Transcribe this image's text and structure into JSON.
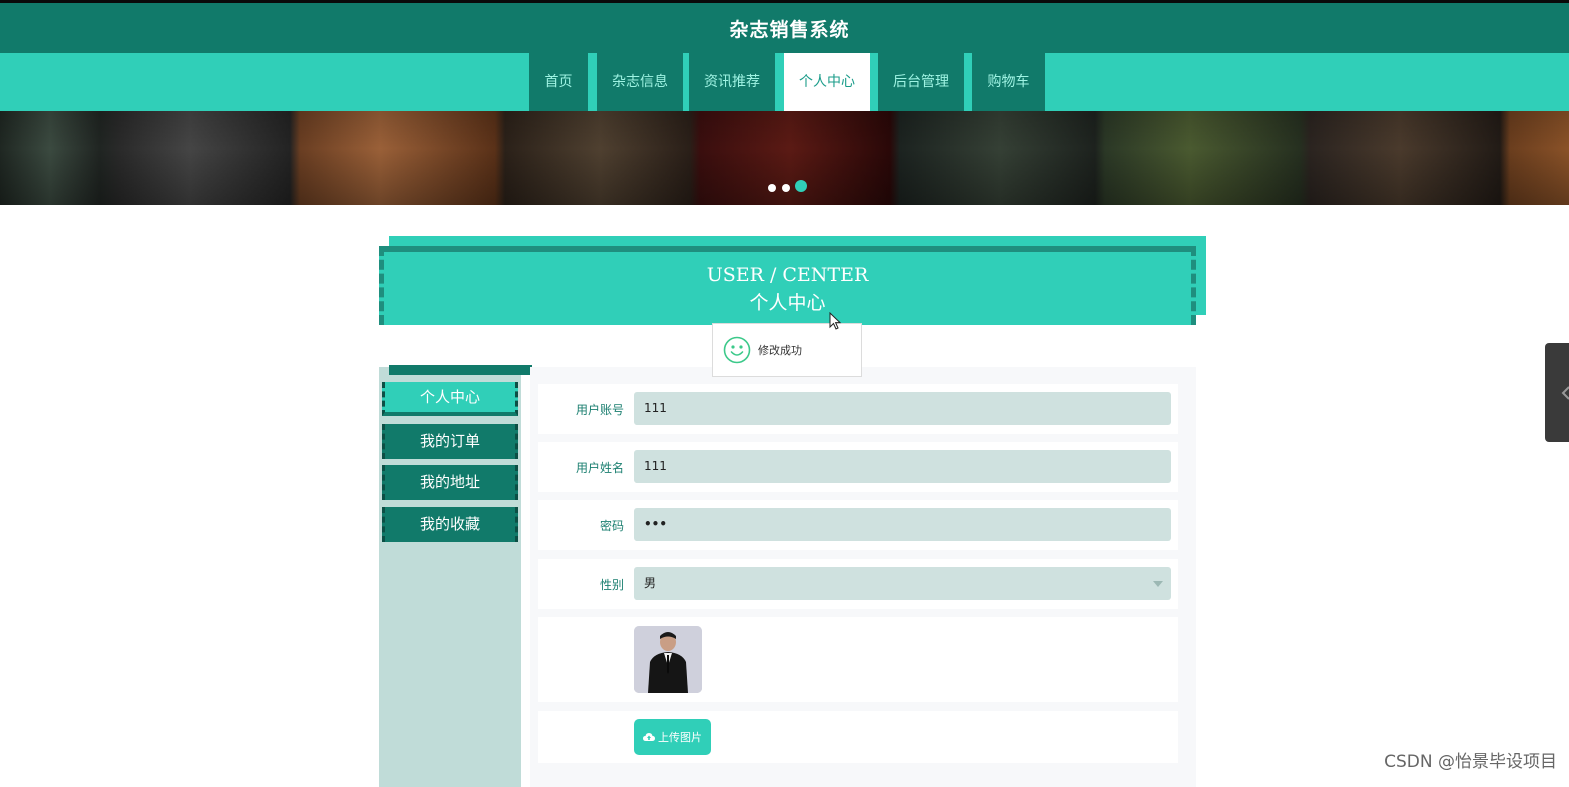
{
  "header": {
    "title": "杂志销售系统"
  },
  "nav": {
    "items": [
      {
        "label": "首页"
      },
      {
        "label": "杂志信息"
      },
      {
        "label": "资讯推荐"
      },
      {
        "label": "个人中心",
        "active": true
      },
      {
        "label": "后台管理"
      },
      {
        "label": "购物车"
      }
    ]
  },
  "banner": {
    "slide_count": 3,
    "active_slide": 3
  },
  "section": {
    "title_en": "USER / CENTER",
    "title_cn": "个人中心"
  },
  "toast": {
    "message": "修改成功",
    "icon": "smile-icon"
  },
  "sidebar": {
    "items": [
      {
        "label": "个人中心",
        "active": true
      },
      {
        "label": "我的订单"
      },
      {
        "label": "我的地址"
      },
      {
        "label": "我的收藏"
      }
    ]
  },
  "form": {
    "account": {
      "label": "用户账号",
      "value": "111"
    },
    "name": {
      "label": "用户姓名",
      "value": "111"
    },
    "password": {
      "label": "密码",
      "value": "•••"
    },
    "gender": {
      "label": "性别",
      "value": "男"
    },
    "upload": {
      "label": "上传图片",
      "icon": "cloud-upload-icon"
    }
  },
  "watermark": "CSDN @怡景毕设项目",
  "colors": {
    "primary": "#30cfb8",
    "dark": "#117a6a",
    "input_bg": "#cfe1df",
    "panel_bg": "#c0dcd8"
  }
}
